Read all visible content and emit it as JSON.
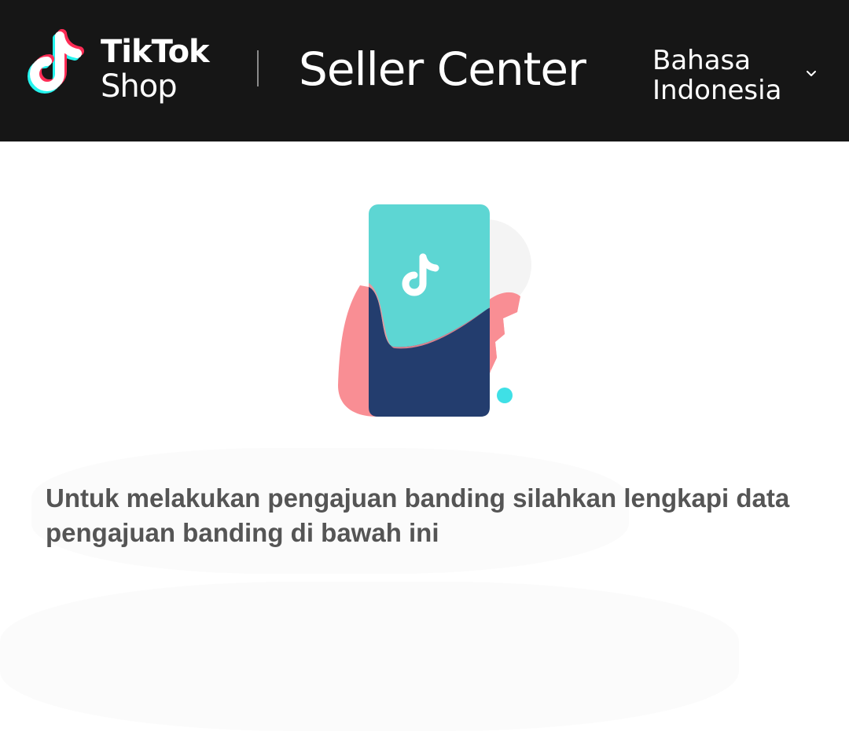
{
  "header": {
    "brand_line1": "TikTok",
    "brand_line2": "Shop",
    "title": "Seller Center",
    "language_line1": "Bahasa",
    "language_line2": "Indonesia",
    "language_icon": "chevron-down-icon",
    "background": "#161616"
  },
  "main": {
    "illustration_icon": "phone-in-hand-icon",
    "message": "Untuk melakukan pengajuan banding silahkan lengkapi data pengajuan banding di bawah ini",
    "colors": {
      "teal": "#5dd6d3",
      "navy": "#233d6e",
      "pink": "#f98e94",
      "dot": "#3fe0e6"
    }
  }
}
